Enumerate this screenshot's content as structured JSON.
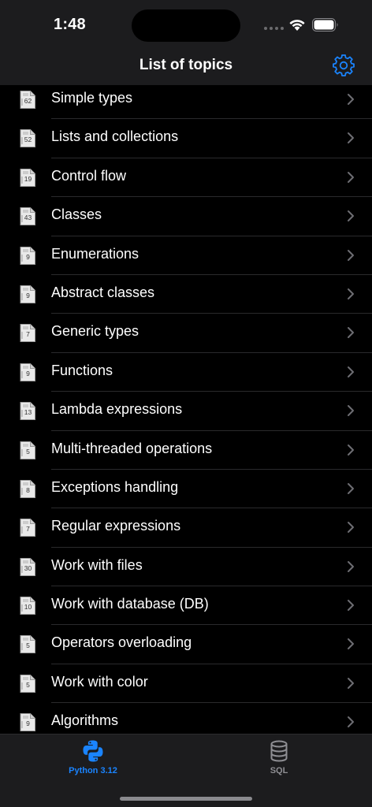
{
  "status_bar": {
    "time": "1:48"
  },
  "nav": {
    "title": "List of topics",
    "settings_icon": "gear-icon",
    "accent": "#1a84ff"
  },
  "topics": [
    {
      "label": "Simple types",
      "count": "62"
    },
    {
      "label": "Lists and collections",
      "count": "52"
    },
    {
      "label": "Control flow",
      "count": "19"
    },
    {
      "label": "Classes",
      "count": "43"
    },
    {
      "label": "Enumerations",
      "count": "9"
    },
    {
      "label": "Abstract classes",
      "count": "9"
    },
    {
      "label": "Generic types",
      "count": "7"
    },
    {
      "label": "Functions",
      "count": "9"
    },
    {
      "label": "Lambda expressions",
      "count": "13"
    },
    {
      "label": "Multi-threaded operations",
      "count": "5"
    },
    {
      "label": "Exceptions handling",
      "count": "8"
    },
    {
      "label": "Regular expressions",
      "count": "7"
    },
    {
      "label": "Work with files",
      "count": "30"
    },
    {
      "label": "Work with database (DB)",
      "count": "10"
    },
    {
      "label": "Operators overloading",
      "count": "5"
    },
    {
      "label": "Work with color",
      "count": "5"
    },
    {
      "label": "Algorithms",
      "count": "9"
    }
  ],
  "tabs": [
    {
      "label": "Python 3.12",
      "icon": "python-icon",
      "selected": true
    },
    {
      "label": "SQL",
      "icon": "database-icon",
      "selected": false
    }
  ]
}
